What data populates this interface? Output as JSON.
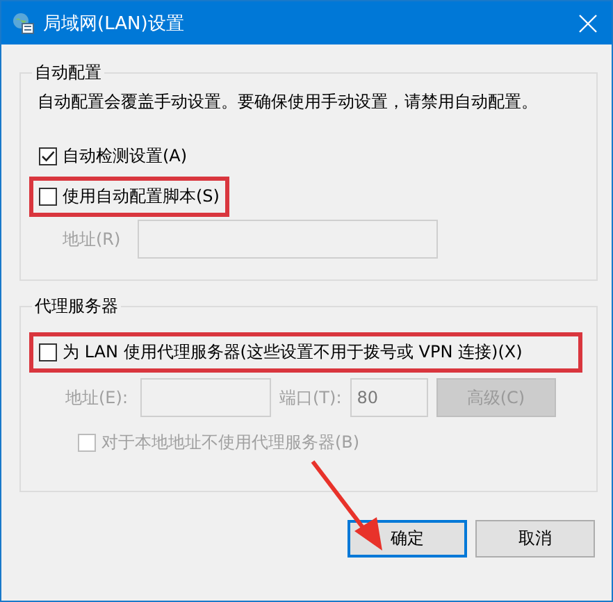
{
  "window": {
    "title": "局域网(LAN)设置"
  },
  "auto_config": {
    "title": "自动配置",
    "description": "自动配置会覆盖手动设置。要确保使用手动设置，请禁用自动配置。",
    "options": [
      {
        "label": "自动检测设置(A)",
        "checked": true,
        "disabled": false,
        "highlighted": false
      },
      {
        "label": "使用自动配置脚本(S)",
        "checked": false,
        "disabled": false,
        "highlighted": true
      }
    ],
    "address": {
      "label": "地址(R)",
      "disabled": true
    }
  },
  "proxy": {
    "title": "代理服务器",
    "use_proxy": {
      "label": "为 LAN 使用代理服务器(这些设置不用于拨号或 VPN 连接)(X)",
      "checked": false,
      "disabled": false,
      "highlighted": true
    },
    "address": {
      "label": "地址(E):",
      "disabled": true
    },
    "port": {
      "label": "端口(T):",
      "value": "80",
      "disabled": true
    },
    "advanced_button": {
      "label": "高级(C)",
      "disabled": true
    },
    "bypass_local": {
      "label": "对于本地地址不使用代理服务器(B)",
      "checked": false,
      "disabled": true,
      "highlighted": false
    }
  },
  "buttons": [
    {
      "label": "确定",
      "focused": true,
      "pointed": true
    },
    {
      "label": "取消",
      "focused": false,
      "pointed": false
    }
  ]
}
